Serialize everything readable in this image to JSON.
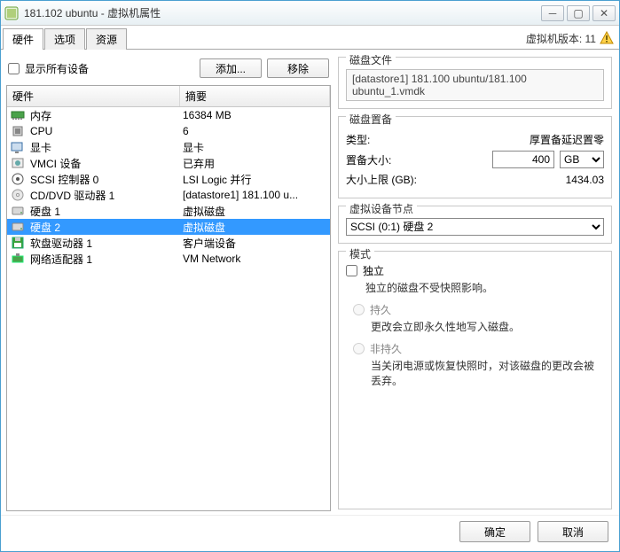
{
  "window": {
    "title": "181.102 ubuntu - 虚拟机属性"
  },
  "tabs": {
    "hardware": "硬件",
    "options": "选项",
    "resources": "资源"
  },
  "vm_version_label": "虚拟机版本: 11",
  "toolbar": {
    "show_all": "显示所有设备",
    "add": "添加...",
    "remove": "移除"
  },
  "columns": {
    "hardware": "硬件",
    "summary": "摘要"
  },
  "hardware": [
    {
      "icon": "memory",
      "name": "内存",
      "summary": "16384 MB",
      "selected": false
    },
    {
      "icon": "cpu",
      "name": "CPU",
      "summary": "6",
      "selected": false
    },
    {
      "icon": "video",
      "name": "显卡",
      "summary": "显卡",
      "selected": false
    },
    {
      "icon": "vmci",
      "name": "VMCI 设备",
      "summary": "已弃用",
      "selected": false
    },
    {
      "icon": "scsi",
      "name": "SCSI 控制器 0",
      "summary": "LSI Logic 并行",
      "selected": false
    },
    {
      "icon": "cd",
      "name": "CD/DVD 驱动器 1",
      "summary": "[datastore1] 181.100 u...",
      "selected": false
    },
    {
      "icon": "disk",
      "name": "硬盘 1",
      "summary": "虚拟磁盘",
      "selected": false
    },
    {
      "icon": "disk",
      "name": "硬盘 2",
      "summary": "虚拟磁盘",
      "selected": true
    },
    {
      "icon": "floppy",
      "name": "软盘驱动器 1",
      "summary": "客户端设备",
      "selected": false
    },
    {
      "icon": "nic",
      "name": "网络适配器 1",
      "summary": "VM Network",
      "selected": false
    }
  ],
  "disk_file": {
    "title": "磁盘文件",
    "value": "[datastore1]  181.100 ubuntu/181.100 ubuntu_1.vmdk"
  },
  "disk_prov": {
    "title": "磁盘置备",
    "type_label": "类型:",
    "type_value": "厚置备延迟置零",
    "size_label": "置备大小:",
    "size_value": "400",
    "size_unit_options": [
      "GB"
    ],
    "size_unit": "GB",
    "max_label": "大小上限 (GB):",
    "max_value": "1434.03"
  },
  "virtual_node": {
    "title": "虚拟设备节点",
    "value": "SCSI (0:1) 硬盘 2"
  },
  "mode": {
    "title": "模式",
    "indep_label": "独立",
    "indep_desc": "独立的磁盘不受快照影响。",
    "persist_label": "持久",
    "persist_desc": "更改会立即永久性地写入磁盘。",
    "nonpersist_label": "非持久",
    "nonpersist_desc": "当关闭电源或恢复快照时，对该磁盘的更改会被丢弃。"
  },
  "footer": {
    "ok": "确定",
    "cancel": "取消"
  }
}
